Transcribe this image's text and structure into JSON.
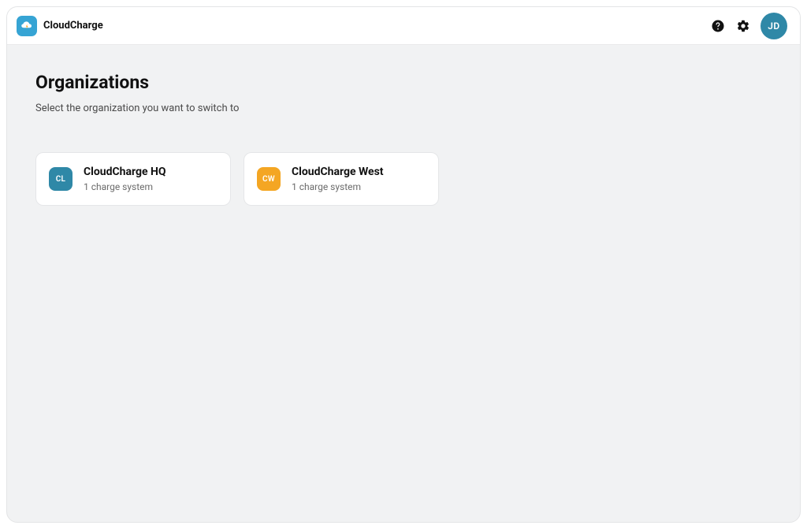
{
  "header": {
    "brand": "CloudCharge",
    "avatar_initials": "JD"
  },
  "page": {
    "title": "Organizations",
    "subtitle": "Select the organization you want to switch to"
  },
  "organizations": [
    {
      "initials": "CL",
      "name": "CloudCharge HQ",
      "meta": "1 charge system",
      "avatar_color": "#2f88a7"
    },
    {
      "initials": "CW",
      "name": "CloudCharge West",
      "meta": "1 charge system",
      "avatar_color": "#f4a623"
    }
  ]
}
